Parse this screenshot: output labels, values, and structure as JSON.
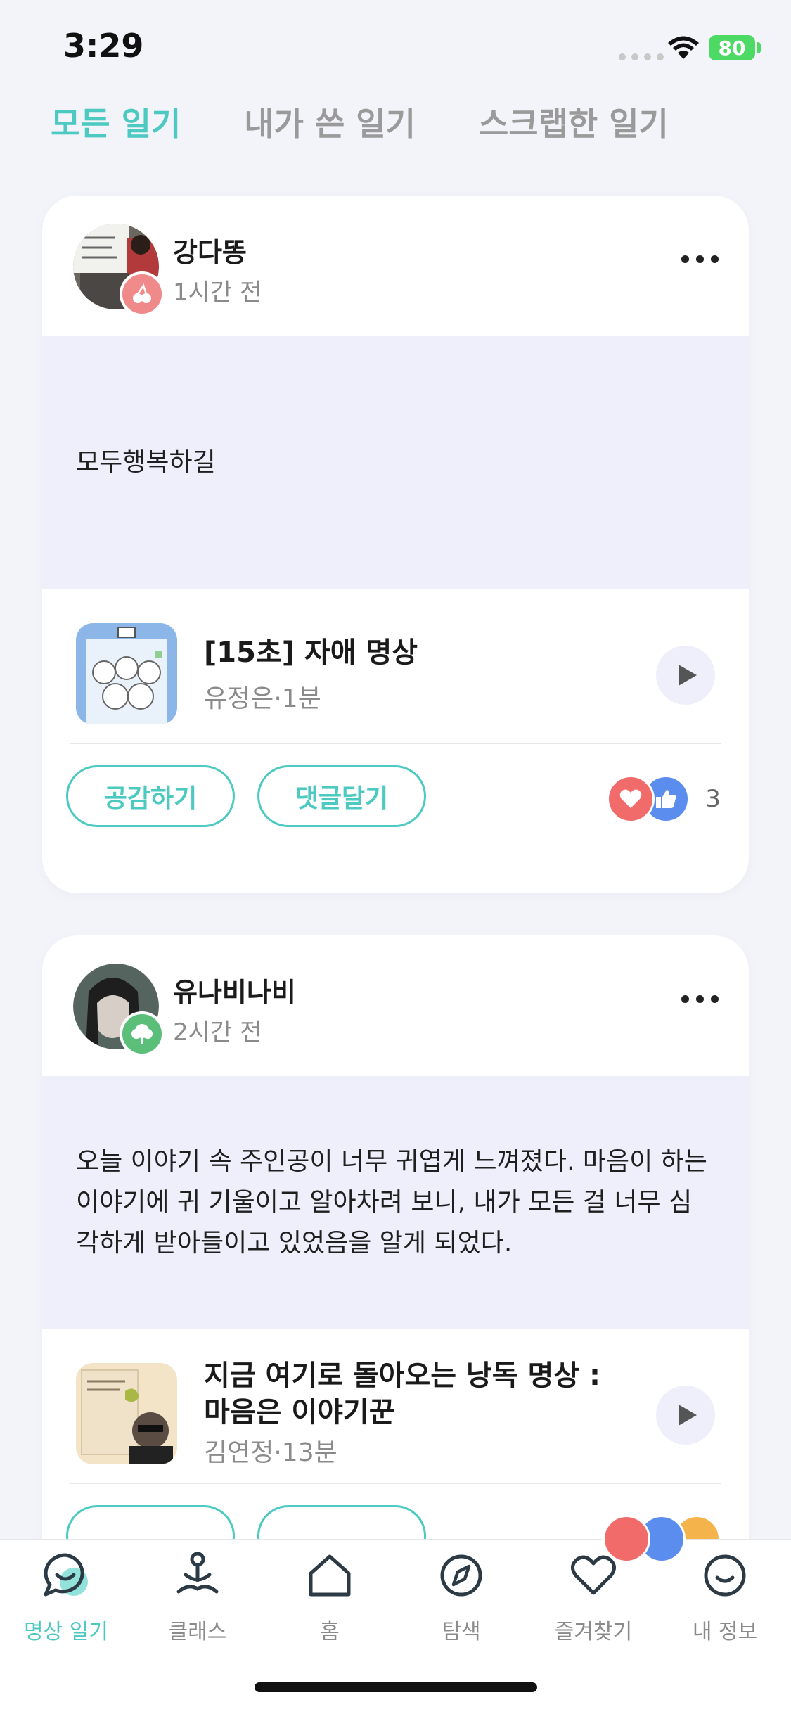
{
  "status_bar": {
    "time": "3:29",
    "battery": "80"
  },
  "tabs": [
    {
      "label": "모든 일기",
      "active": true
    },
    {
      "label": "내가 쓴 일기",
      "active": false
    },
    {
      "label": "스크랩한 일기",
      "active": false
    }
  ],
  "posts": [
    {
      "author": "강다똥",
      "time_ago": "1시간 전",
      "body": "모두행복하길",
      "media": {
        "title": "[15초] 자애 명상",
        "subtitle": "유정은·1분"
      },
      "empathize_label": "공감하기",
      "comment_label": "댓글달기",
      "reaction_count": "3"
    },
    {
      "author": "유나비나비",
      "time_ago": "2시간 전",
      "body": "오늘 이야기 속 주인공이 너무 귀엽게 느껴졌다. 마음이 하는 이야기에 귀 기울이고 알아차려 보니, 내가 모든 걸 너무 심각하게 받아들이고 있었음을 알게 되었다.",
      "media": {
        "title": "지금 여기로 돌아오는 낭독 명상 : 마음은 이야기꾼",
        "subtitle": "김연정·13분"
      }
    }
  ],
  "bottom_nav": [
    {
      "label": "명상 일기",
      "icon": "chat-bubble-icon",
      "active": true
    },
    {
      "label": "클래스",
      "icon": "meditation-person-icon",
      "active": false
    },
    {
      "label": "홈",
      "icon": "home-icon",
      "active": false
    },
    {
      "label": "탐색",
      "icon": "compass-icon",
      "active": false
    },
    {
      "label": "즐겨찾기",
      "icon": "heart-icon",
      "active": false
    },
    {
      "label": "내 정보",
      "icon": "smile-icon",
      "active": false
    }
  ],
  "colors": {
    "accent": "#4CC9C0",
    "background": "#F3F3FA",
    "diary_bg": "#EEEFFB",
    "heart": "#F26B6B",
    "like": "#5B8DEF"
  }
}
